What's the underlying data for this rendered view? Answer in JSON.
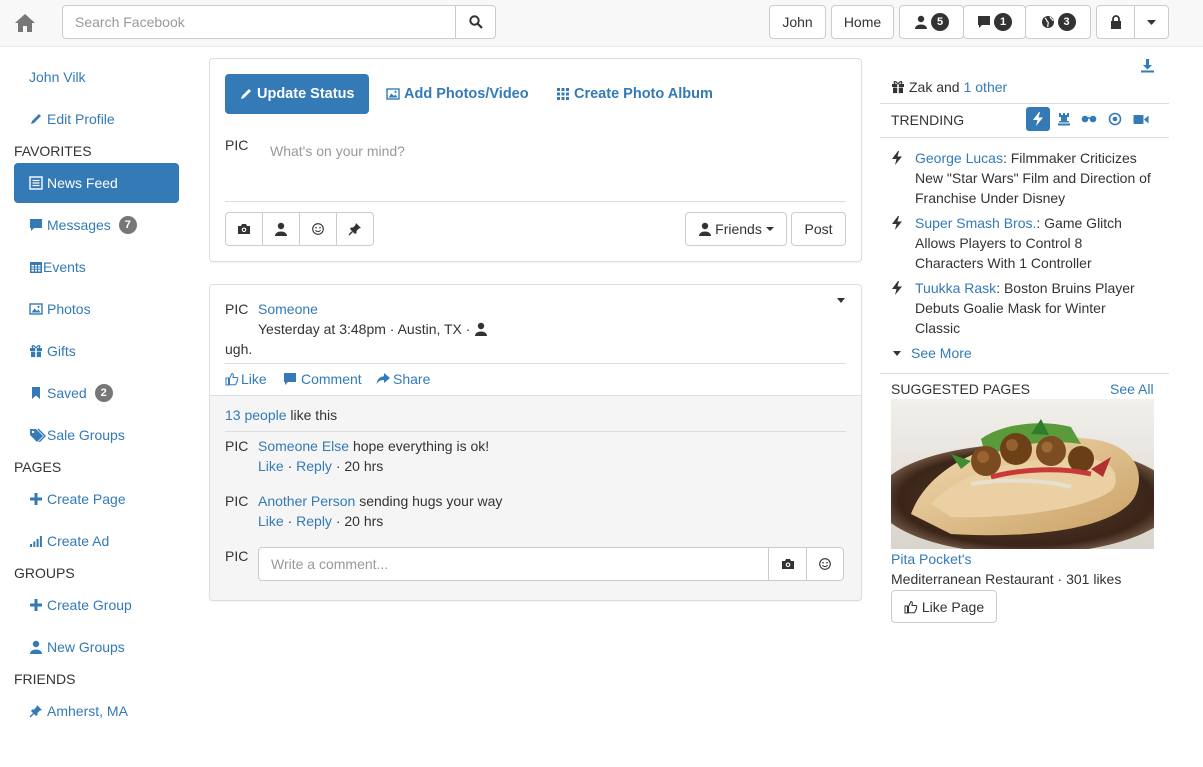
{
  "topbar": {
    "search_placeholder": "Search Facebook",
    "user_label": "John",
    "home_label": "Home",
    "friend_requests_count": "5",
    "messages_count": "1",
    "notifications_count": "3"
  },
  "sidebar": {
    "profile_name": "John Vilk",
    "edit_profile": "Edit Profile",
    "favorites_header": "FAVORITES",
    "news_feed": "News Feed",
    "messages": "Messages",
    "messages_badge": "7",
    "events": "Events",
    "photos": "Photos",
    "gifts": "Gifts",
    "saved": "Saved",
    "saved_badge": "2",
    "sale_groups": "Sale Groups",
    "pages_header": "PAGES",
    "create_page": "Create Page",
    "create_ad": "Create Ad",
    "groups_header": "GROUPS",
    "create_group": "Create Group",
    "new_groups": "New Groups",
    "friends_header": "FRIENDS",
    "friends_location": "Amherst, MA"
  },
  "composer": {
    "tab_update_status": "Update Status",
    "tab_add_photos": "Add Photos/Video",
    "tab_create_album": "Create Photo Album",
    "pic_label": "PIC",
    "placeholder": "What's on your mind?",
    "audience_label": "Friends",
    "post_label": "Post"
  },
  "post": {
    "pic_label": "PIC",
    "author": "Someone",
    "meta": "Yesterday at 3:48pm · Austin, TX ·",
    "body": "ugh.",
    "like_label": "Like",
    "comment_label": "Comment",
    "share_label": "Share",
    "likes_link": "13 people",
    "likes_suffix": "like this",
    "comments": [
      {
        "pic": "PIC",
        "author": "Someone Else",
        "text": "hope everything is ok!",
        "like": "Like",
        "reply": "Reply",
        "time": "20 hrs"
      },
      {
        "pic": "PIC",
        "author": "Another Person",
        "text": "sending hugs your way",
        "like": "Like",
        "reply": "Reply",
        "time": "20 hrs"
      }
    ],
    "sep": "·",
    "new_comment_pic": "PIC",
    "comment_placeholder": "Write a comment..."
  },
  "right": {
    "birthday_name": "Zak and",
    "birthday_other": "1 other",
    "trending_header": "TRENDING",
    "trending": [
      {
        "link": "George Lucas",
        "text": ": Filmmaker Criticizes New \"Star Wars\" Film and Direction of Franchise Under Disney"
      },
      {
        "link": "Super Smash Bros.",
        "text": ": Game Glitch Allows Players to Control 8 Characters With 1 Controller"
      },
      {
        "link": "Tuukka Rask",
        "text": ": Boston Bruins Player Debuts Goalie Mask for Winter Classic"
      }
    ],
    "see_more": "See More",
    "suggested_header": "SUGGESTED PAGES",
    "see_all": "See All",
    "page_name": "Pita Pocket's",
    "page_meta": "Mediterranean Restaurant · 301 likes",
    "like_page": "Like Page"
  }
}
